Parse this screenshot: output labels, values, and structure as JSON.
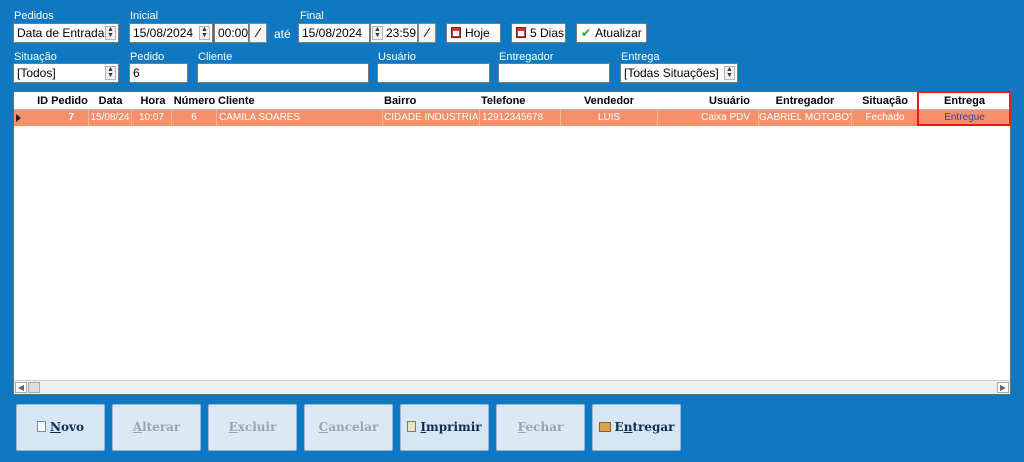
{
  "filters": {
    "pedidos": {
      "label": "Pedidos",
      "value": "Data de Entrada"
    },
    "inicial": {
      "label": "Inicial",
      "date": "15/08/2024",
      "time": "00:00"
    },
    "ate": "até",
    "final": {
      "label": "Final",
      "date": "15/08/2024",
      "time": "23:59"
    },
    "hoje_label": "Hoje",
    "cinco_dias_label": "5 Dias",
    "atualizar_label": "Atualizar",
    "situacao": {
      "label": "Situação",
      "value": "[Todos]"
    },
    "pedido": {
      "label": "Pedido",
      "value": "6"
    },
    "cliente": {
      "label": "Cliente",
      "value": ""
    },
    "usuario": {
      "label": "Usuário",
      "value": ""
    },
    "entregador": {
      "label": "Entregador",
      "value": ""
    },
    "entrega": {
      "label": "Entrega",
      "value": "[Todas Situações]"
    }
  },
  "table": {
    "columns": [
      "ID Pedido",
      "Data",
      "Hora",
      "Número",
      "Cliente",
      "Bairro",
      "Telefone",
      "Vendedor",
      "Usuário",
      "Entregador",
      "Situação",
      "Entrega"
    ],
    "rows": [
      [
        "7",
        "15/08/24",
        "10:07",
        "6",
        "CAMILA SOARES",
        "CIDADE INDUSTRIAL",
        "12912345678",
        "LUIS",
        "Caixa PDV",
        "GABRIEL MOTOBOY",
        "Fechado",
        "Entregue"
      ]
    ]
  },
  "buttons": {
    "novo": {
      "pre": "",
      "key": "N",
      "rest": "ovo"
    },
    "alterar": {
      "pre": "",
      "key": "A",
      "rest": "lterar"
    },
    "excluir": {
      "pre": "",
      "key": "E",
      "rest": "xcluir"
    },
    "cancelar": {
      "pre": "",
      "key": "C",
      "rest": "ancelar"
    },
    "imprimir": {
      "pre": "",
      "key": "I",
      "rest": "mprimir"
    },
    "fechar": {
      "pre": "",
      "key": "F",
      "rest": "echar"
    },
    "entregar": {
      "pre": "E",
      "key": "n",
      "rest": "tregar"
    }
  },
  "colors": {
    "background": "#0f78c3",
    "row": "#f6906b",
    "highlight": "#e21d1d",
    "entrega_text": "#3b3bb0"
  }
}
